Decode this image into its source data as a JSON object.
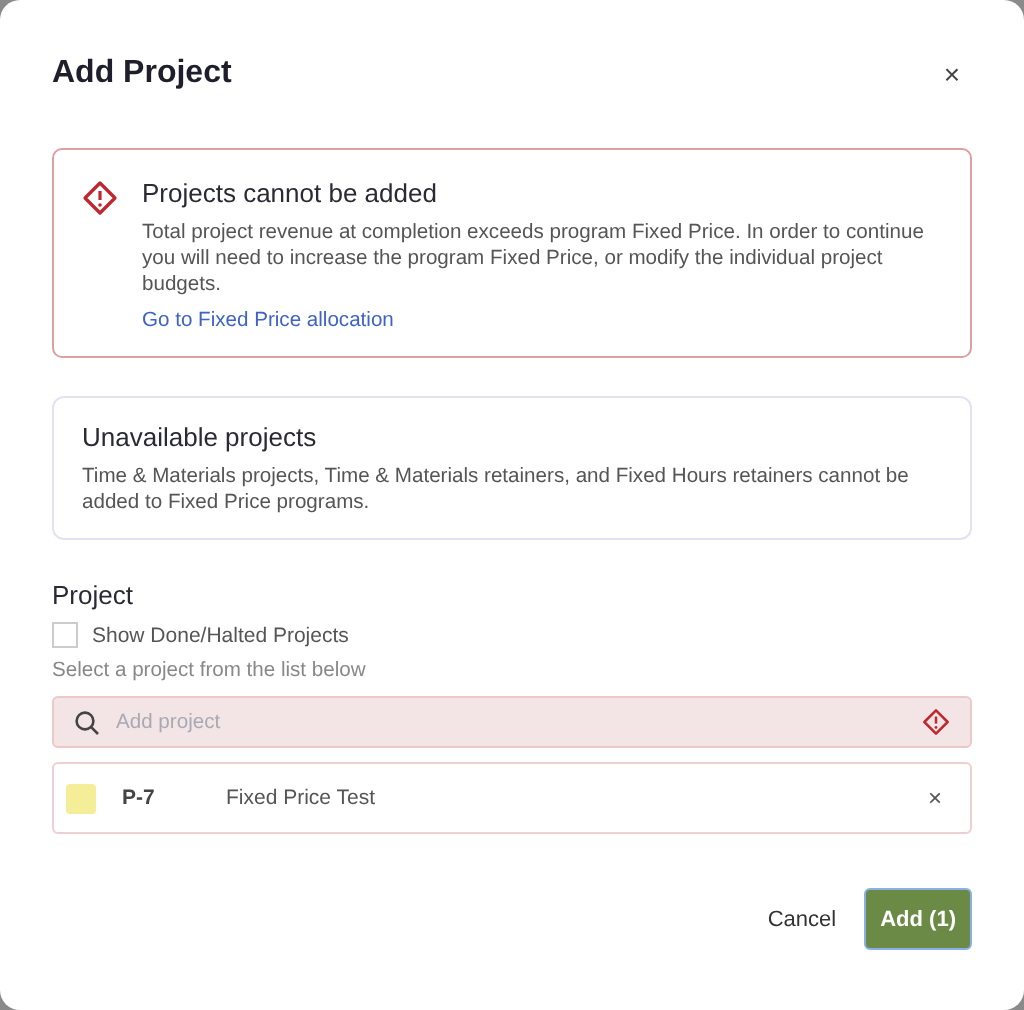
{
  "dialog": {
    "title": "Add Project",
    "close": "×"
  },
  "error_alert": {
    "title": "Projects cannot be added",
    "message": "Total project revenue at completion exceeds program Fixed Price. In order to continue you will need to increase the program Fixed Price, or modify the individual project budgets.",
    "link": "Go to Fixed Price allocation"
  },
  "info_box": {
    "title": "Unavailable projects",
    "message": "Time & Materials projects, Time & Materials retainers, and Fixed Hours retainers cannot be added to Fixed Price programs."
  },
  "project": {
    "label": "Project",
    "show_done": {
      "label": "Show Done/Halted Projects",
      "checked": false
    },
    "hint": "Select a project from the list below",
    "search": {
      "placeholder": "Add project",
      "invalid": true
    },
    "items": [
      {
        "code": "P-7",
        "name": "Fixed Price Test",
        "color": "#f3ee97",
        "remove": "×"
      }
    ]
  },
  "buttons": {
    "cancel": "Cancel",
    "add": "Add (1)"
  }
}
